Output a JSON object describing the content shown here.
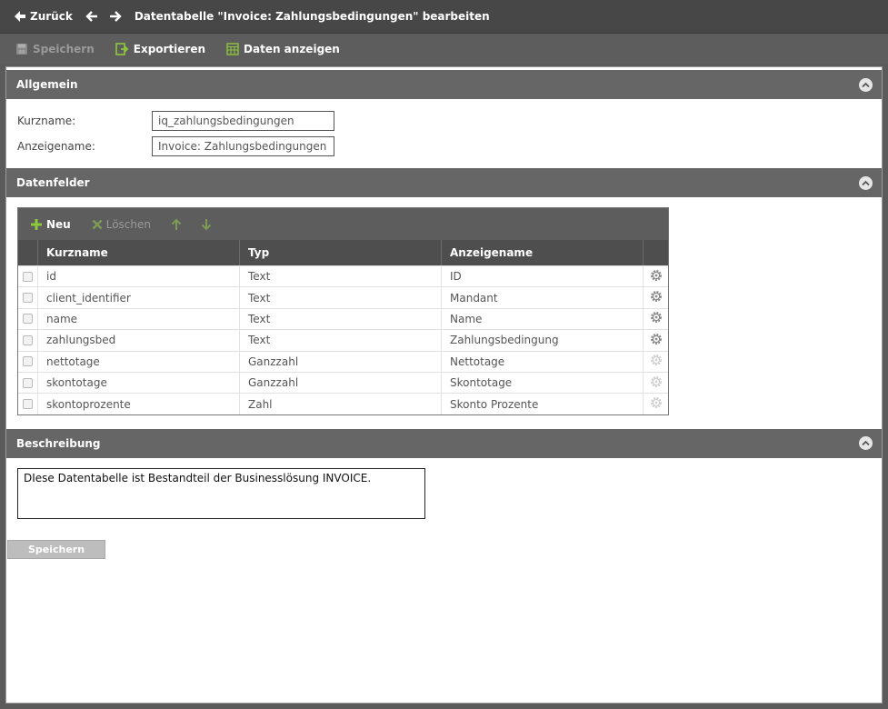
{
  "header": {
    "back_label": "Zurück",
    "title": "Datentabelle \"Invoice: Zahlungsbedingungen\" bearbeiten"
  },
  "toolbar": {
    "save_label": "Speichern",
    "export_label": "Exportieren",
    "show_data_label": "Daten anzeigen"
  },
  "general": {
    "title": "Allgemein",
    "short_name_label": "Kurzname:",
    "short_name_value": "iq_zahlungsbedingungen",
    "display_name_label": "Anzeigename:",
    "display_name_value": "Invoice: Zahlungsbedingungen"
  },
  "fields": {
    "title": "Datenfelder",
    "new_label": "Neu",
    "delete_label": "Löschen",
    "columns": [
      "Kurzname",
      "Typ",
      "Anzeigename"
    ],
    "rows": [
      {
        "name": "id",
        "type": "Text",
        "display": "ID",
        "settings_enabled": true
      },
      {
        "name": "client_identifier",
        "type": "Text",
        "display": "Mandant",
        "settings_enabled": true
      },
      {
        "name": "name",
        "type": "Text",
        "display": "Name",
        "settings_enabled": true
      },
      {
        "name": "zahlungsbed",
        "type": "Text",
        "display": "Zahlungsbedingung",
        "settings_enabled": true
      },
      {
        "name": "nettotage",
        "type": "Ganzzahl",
        "display": "Nettotage",
        "settings_enabled": false
      },
      {
        "name": "skontotage",
        "type": "Ganzzahl",
        "display": "Skontotage",
        "settings_enabled": false
      },
      {
        "name": "skontoprozente",
        "type": "Zahl",
        "display": "Skonto Prozente",
        "settings_enabled": false
      }
    ]
  },
  "description": {
    "title": "Beschreibung",
    "text": "DIese Datentabelle ist Bestandteil der Businesslösung INVOICE."
  },
  "footer": {
    "save_label": "Speichern"
  },
  "colors": {
    "accent_green": "#8dc63f",
    "header_dark": "#474747",
    "section_gray": "#666666"
  }
}
